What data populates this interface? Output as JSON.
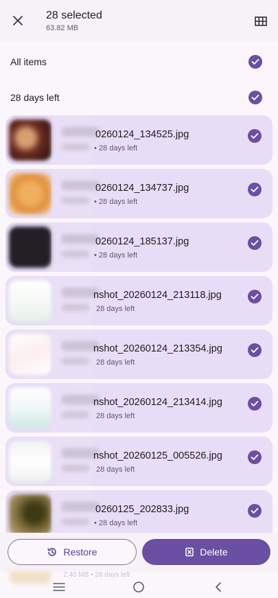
{
  "header": {
    "selected_count": "28 selected",
    "total_size": "63.82 MB"
  },
  "groups": {
    "all_items_label": "All items",
    "days_left_label": "28 days left"
  },
  "files": [
    {
      "name": "0260124_134525.jpg",
      "meta": "• 28 days left",
      "thumb": "food-photo"
    },
    {
      "name": "0260124_134737.jpg",
      "meta": "• 28 days left",
      "thumb": "food-photo"
    },
    {
      "name": "0260124_185137.jpg",
      "meta": "• 28 days left",
      "thumb": "dark-photo"
    },
    {
      "name": "nshot_20260124_213118.jpg",
      "meta": "28 days left",
      "thumb": "screenshot"
    },
    {
      "name": "nshot_20260124_213354.jpg",
      "meta": "28 days left",
      "thumb": "screenshot"
    },
    {
      "name": "nshot_20260124_213414.jpg",
      "meta": "28 days left",
      "thumb": "screenshot"
    },
    {
      "name": "nshot_20260125_005526.jpg",
      "meta": "28 days left",
      "thumb": "screenshot"
    },
    {
      "name": "0260125_202833.jpg",
      "meta": "• 28 days left",
      "thumb": "photo"
    }
  ],
  "peek_meta": "2.40 MB • 28 days left",
  "actions": {
    "restore_label": "Restore",
    "delete_label": "Delete"
  },
  "colors": {
    "accent": "#6a4fa2",
    "card_bg": "#e8ddf7",
    "background": "#fbf6fb"
  },
  "icons": {
    "close": "close-icon",
    "grid": "grid-view-icon",
    "check": "check-circle-icon",
    "restore": "restore-history-icon",
    "delete": "delete-icon"
  }
}
